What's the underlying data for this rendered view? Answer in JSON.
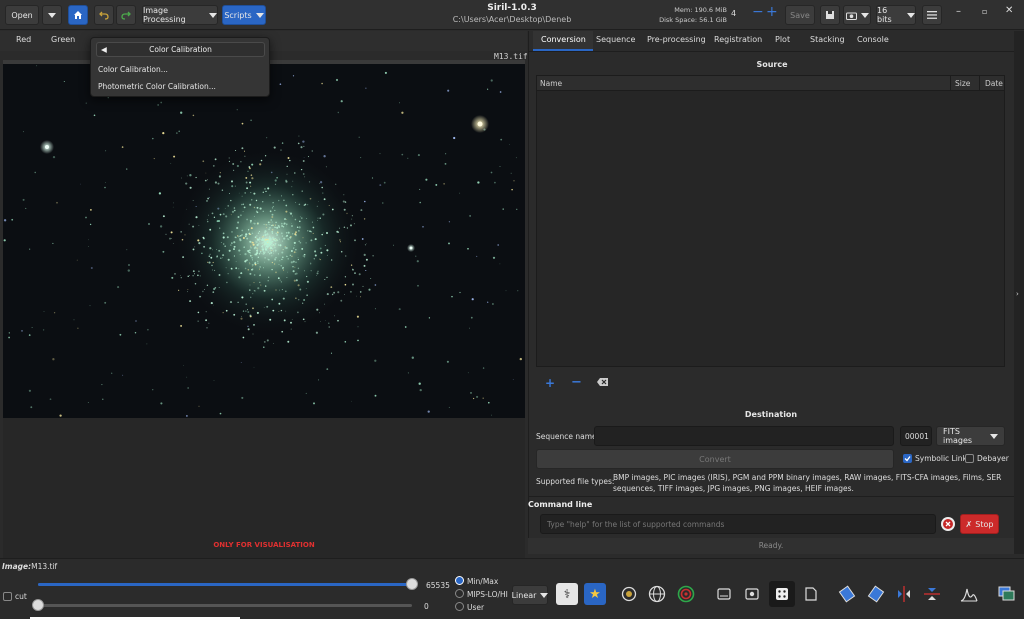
{
  "header": {
    "open_label": "Open",
    "image_processing_label": "Image Processing",
    "scripts_label": "Scripts",
    "app_title": "Siril-1.0.3",
    "working_dir": "C:\\Users\\Acer\\Desktop\\Deneb",
    "mem_label": "Mem: 190.6 MiB",
    "disk_label": "Disk Space: 56.1 GiB",
    "threads": "4",
    "save_label": "Save",
    "bitdepth_label": "16 bits"
  },
  "popover": {
    "title": "Color Calibration",
    "items": [
      "Color Calibration...",
      "Photometric Color Calibration..."
    ]
  },
  "channels": [
    "Red",
    "Green"
  ],
  "image": {
    "filename": "M13.tif",
    "vis_label": "ONLY FOR VISUALISATION"
  },
  "right_tabs": [
    "Conversion",
    "Sequence",
    "Pre-processing",
    "Registration",
    "Plot",
    "Stacking",
    "Console"
  ],
  "conversion": {
    "source_title": "Source",
    "columns": [
      "Name",
      "Size",
      "Date"
    ],
    "destination_title": "Destination",
    "sequence_name_label": "Sequence name:",
    "sequence_index": "00001",
    "format_label": "FITS images",
    "convert_label": "Convert",
    "symbolic_link_label": "Symbolic Link",
    "debayer_label": "Debayer",
    "supported_label": "Supported file types:",
    "supported_types": "BMP images, PIC images (IRIS), PGM and PPM binary images, RAW images, FITS-CFA images, Films, SER sequences, TIFF images, JPG images, PNG images, HEIF images."
  },
  "command": {
    "title": "Command line",
    "placeholder": "Type \"help\" for the list of supported commands",
    "stop_label": "Stop",
    "status": "Ready."
  },
  "bottom": {
    "image_label": "Image:",
    "image_name": "M13.tif",
    "cut_label": "cut",
    "max_value": "65535",
    "min_value": "0",
    "radio_options": [
      "Min/Max",
      "MIPS-LO/HI",
      "User"
    ],
    "scale_label": "Linear"
  },
  "colors": {
    "accent": "#2a66c4",
    "stop": "#cc2a2a",
    "vis_red": "#e03030"
  }
}
